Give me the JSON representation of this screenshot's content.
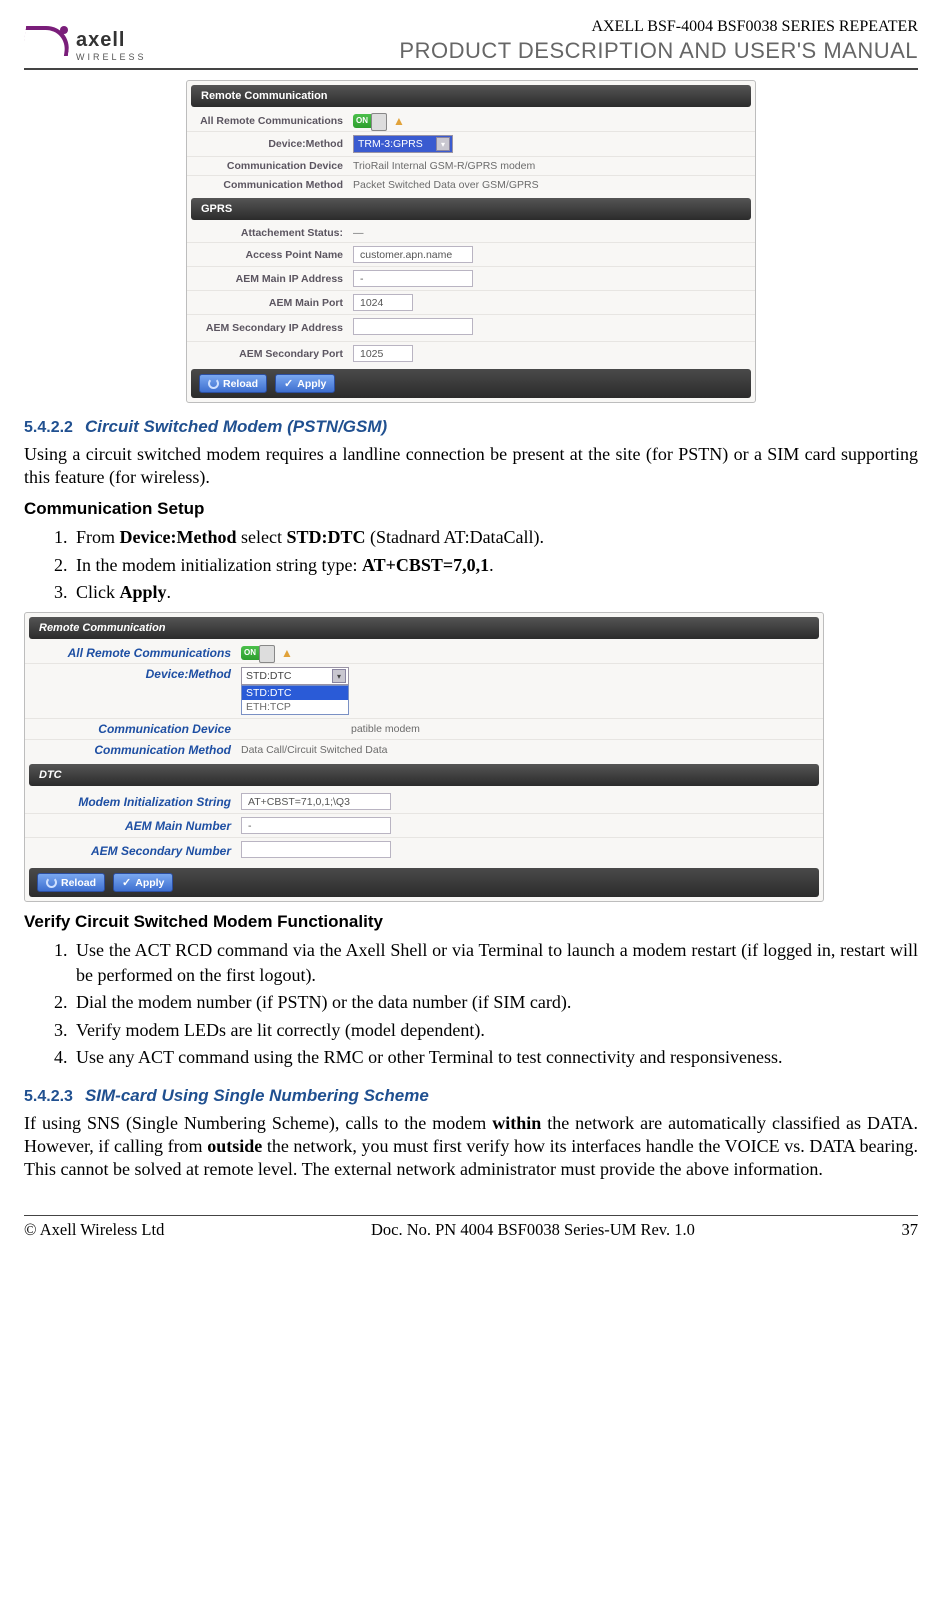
{
  "header": {
    "brand": "axell",
    "brand_sub": "WIRELESS",
    "model_line": "AXELL BSF-4004 BSF0038 SERIES REPEATER",
    "product_line": "PRODUCT DESCRIPTION AND USER'S MANUAL"
  },
  "shot1": {
    "sec1_title": "Remote Communication",
    "rows1": {
      "all_comm_label": "All Remote Communications",
      "on_text": "ON",
      "dev_method_label": "Device:Method",
      "dev_method_value": "TRM-3:GPRS",
      "comm_device_label": "Communication Device",
      "comm_device_value": "TrioRail Internal GSM-R/GPRS modem",
      "comm_method_label": "Communication Method",
      "comm_method_value": "Packet Switched Data over GSM/GPRS"
    },
    "sec2_title": "GPRS",
    "rows2": {
      "attach_label": "Attachement Status:",
      "apn_label": "Access Point Name",
      "apn_value": "customer.apn.name",
      "main_ip_label": "AEM Main IP Address",
      "main_ip_value": "-",
      "main_port_label": "AEM Main Port",
      "main_port_value": "1024",
      "sec_ip_label": "AEM Secondary IP Address",
      "sec_ip_value": "",
      "sec_port_label": "AEM Secondary Port",
      "sec_port_value": "1025"
    },
    "btn_reload": "Reload",
    "btn_apply": "Apply"
  },
  "section1": {
    "num": "5.4.2.2",
    "title": "Circuit Switched Modem (PSTN/GSM)",
    "para": "Using a circuit switched modem requires a landline connection be present at the site (for PSTN) or a SIM card supporting this feature (for wireless).",
    "comm_setup_heading": "Communication Setup",
    "steps": {
      "s1a": "From ",
      "s1b": "Device:Method",
      "s1c": " select ",
      "s1d": "STD:DTC",
      "s1e": " (Stadnard AT:DataCall).",
      "s2a": "In the modem initialization string type: ",
      "s2b": "AT+CBST=7,0,1",
      "s2c": ".",
      "s3a": "Click ",
      "s3b": "Apply",
      "s3c": "."
    }
  },
  "shot2": {
    "sec1_title": "Remote Communication",
    "rows1": {
      "all_comm_label": "All Remote Communications",
      "on_text": "ON",
      "dev_method_label": "Device:Method",
      "dev_method_selected": "STD:DTC",
      "dev_method_opt1": "STD:DTC",
      "dev_method_opt2": "ETH:TCP",
      "comm_device_label": "Communication Device",
      "comm_device_value_tail": "patible modem",
      "comm_method_label": "Communication Method",
      "comm_method_value": "Data Call/Circuit Switched Data"
    },
    "sec2_title": "DTC",
    "rows2": {
      "init_label": "Modem Initialization String",
      "init_value": "AT+CBST=71,0,1;\\Q3",
      "main_num_label": "AEM Main Number",
      "main_num_value": "-",
      "sec_num_label": "AEM Secondary Number",
      "sec_num_value": ""
    },
    "btn_reload": "Reload",
    "btn_apply": "Apply"
  },
  "verify": {
    "heading": "Verify Circuit Switched Modem Functionality",
    "s1": "Use the ACT RCD command via the Axell Shell or via Terminal to launch a modem restart (if logged in, restart will be performed on the first logout).",
    "s2": "Dial the modem number (if PSTN) or the data number (if SIM card).",
    "s3": "Verify modem LEDs are lit correctly (model dependent).",
    "s4": "Use any ACT command using the RMC or other Terminal to test connectivity and responsiveness."
  },
  "section2": {
    "num": "5.4.2.3",
    "title": "SIM-card Using Single Numbering Scheme",
    "p_a": "If using SNS (Single Numbering Scheme), calls to the modem ",
    "p_b": "within",
    "p_c": " the network are automatically classified as DATA. However, if calling from ",
    "p_d": "outside",
    "p_e": " the network, you must first verify how its interfaces handle the VOICE vs. DATA bearing. This cannot be solved at remote level. The external network administrator must provide the above information."
  },
  "footer": {
    "left": "© Axell Wireless Ltd",
    "center": "Doc. No. PN 4004 BSF0038 Series-UM Rev. 1.0",
    "right": "37"
  }
}
